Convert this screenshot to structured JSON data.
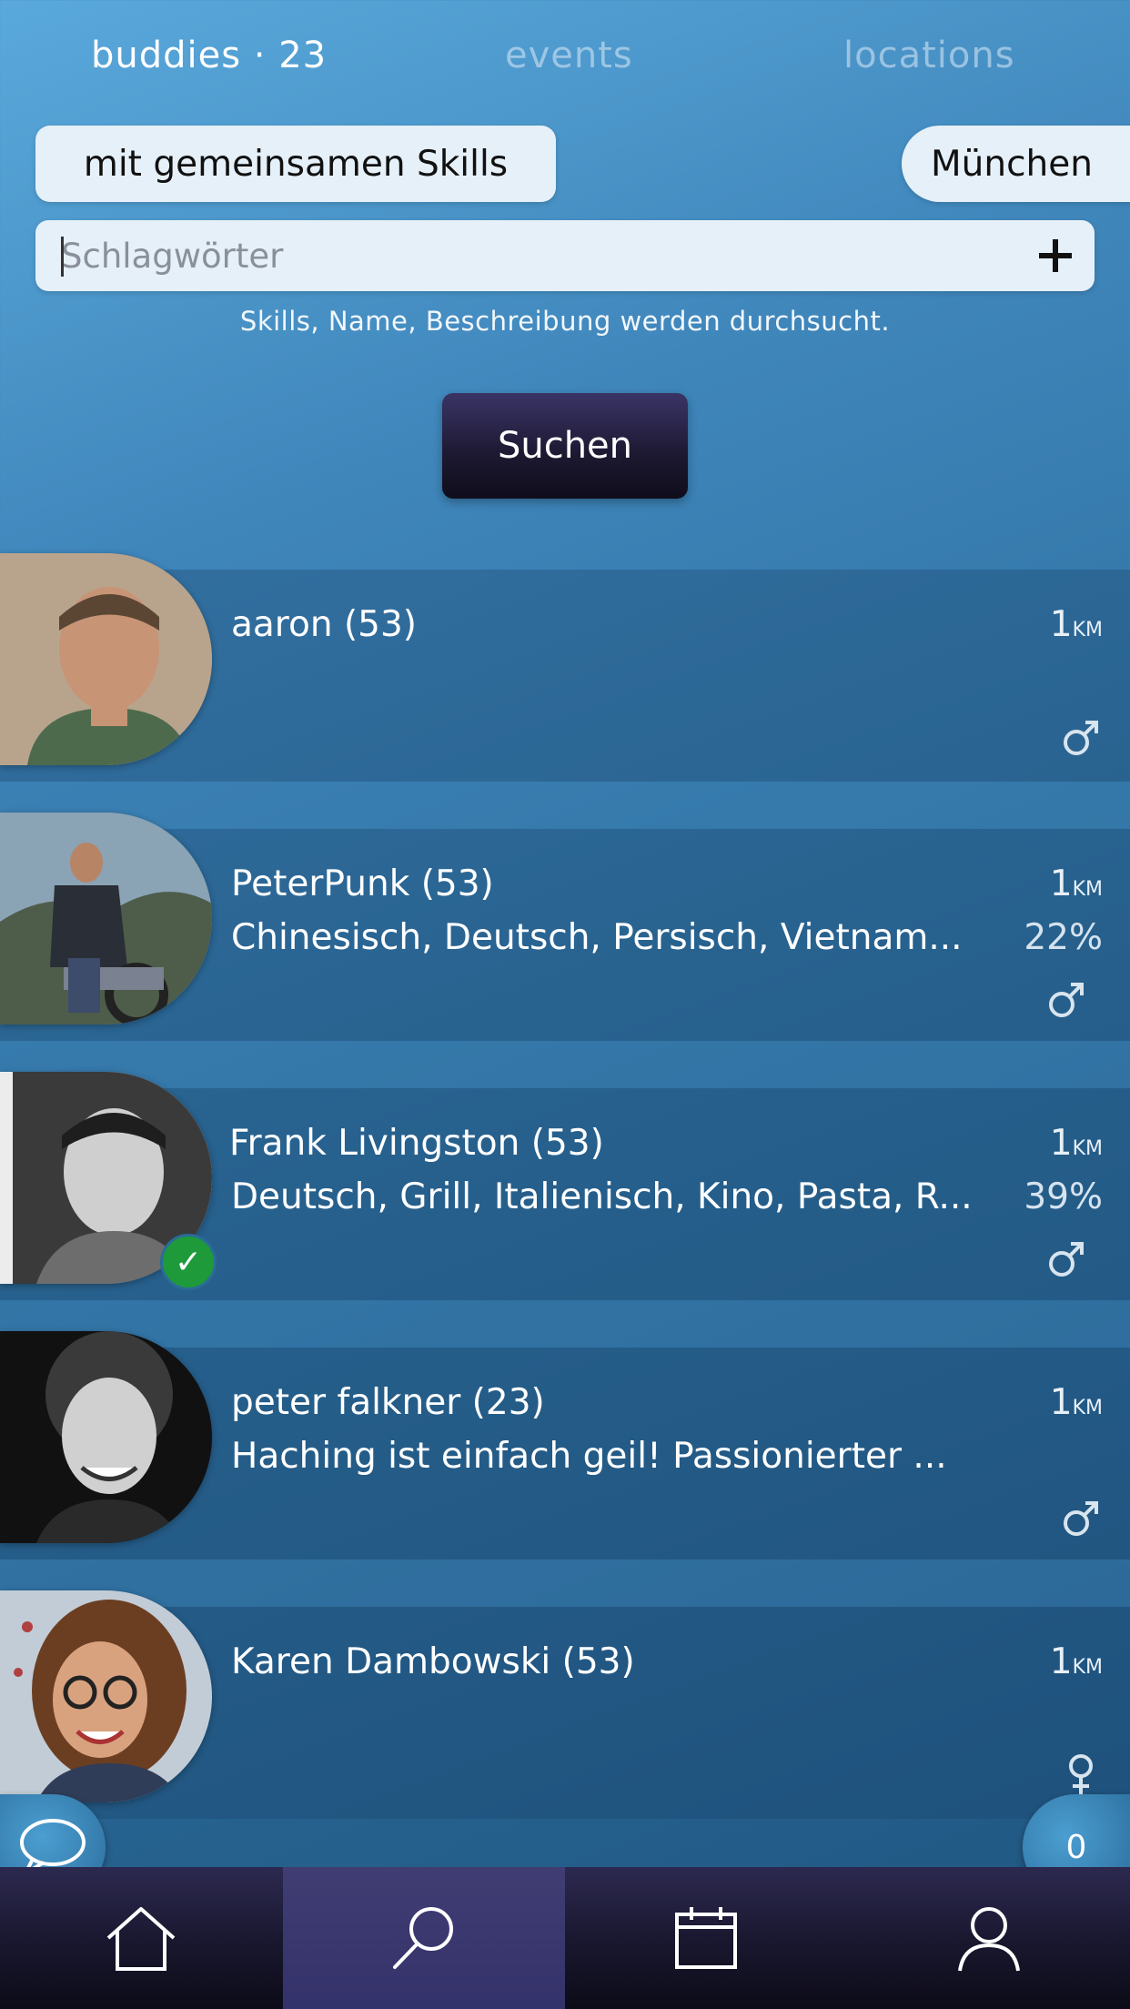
{
  "tabs": {
    "buddies": "buddies · 23",
    "events": "events",
    "locations": "locations"
  },
  "filters": {
    "skills": "mit gemeinsamen Skills",
    "city": "München"
  },
  "search": {
    "placeholder": "Schlagwörter",
    "hint": "Skills, Name, Beschreibung werden durchsucht.",
    "button": "Suchen"
  },
  "buddies": [
    {
      "name": "aaron (53)",
      "skills": "",
      "distance": "1",
      "unit": "KM",
      "match": "",
      "gender": "male",
      "verified": false
    },
    {
      "name": "PeterPunk (53)",
      "skills": "Chinesisch, Deutsch, Persisch, Vietnam...",
      "distance": "1",
      "unit": "KM",
      "match": "22%",
      "gender": "male",
      "verified": false
    },
    {
      "name": "Frank Livingston (53)",
      "skills": "Deutsch, Grill, Italienisch, Kino, Pasta, R...",
      "distance": "1",
      "unit": "KM",
      "match": "39%",
      "gender": "male",
      "verified": true
    },
    {
      "name": "peter falkner (23)",
      "skills": "Haching ist einfach geil! Passionierter ...",
      "distance": "1",
      "unit": "KM",
      "match": "",
      "gender": "male",
      "verified": false
    },
    {
      "name": "Karen Dambowski (53)",
      "skills": "",
      "distance": "1",
      "unit": "KM",
      "match": "",
      "gender": "female",
      "verified": false
    }
  ],
  "badges": {
    "verified_check": "✓",
    "unread_count": "0"
  },
  "nav": [
    "home-icon",
    "search-icon",
    "calendar-icon",
    "profile-icon"
  ],
  "colors": {
    "accent_dark": "#1c1830",
    "verified": "#1e9a3a",
    "pill_bg": "#e6f0f8"
  }
}
